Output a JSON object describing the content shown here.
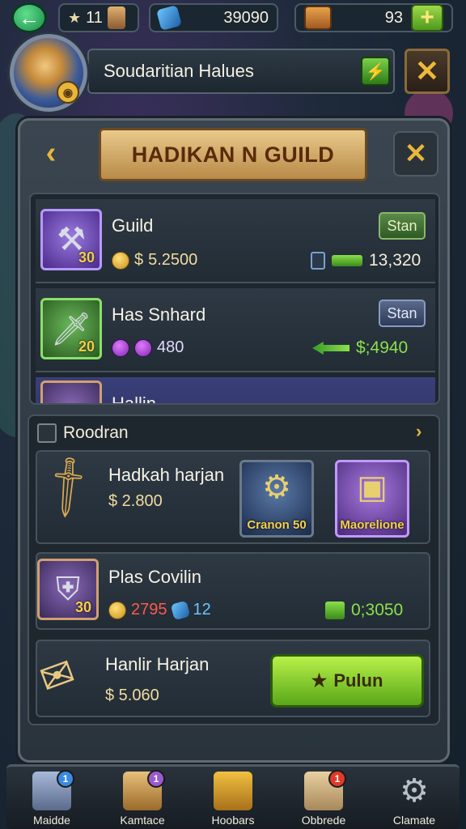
{
  "topbar": {
    "level": "11",
    "gems": "39090",
    "chests": "93"
  },
  "profile": {
    "name": "Soudaritian Halues"
  },
  "panel": {
    "title": "HADIKAN N GUILD"
  },
  "top_list": [
    {
      "name": "Guild",
      "level": "30",
      "cost": "5.2500",
      "button": "Stan",
      "stat": "13,320"
    },
    {
      "name": "Has Snhard",
      "level": "20",
      "cost": "480",
      "button": "Stan",
      "stat": "$;4940"
    },
    {
      "name": "Hallin"
    }
  ],
  "section2": {
    "title": "Roodran",
    "card1": {
      "name": "Hadkah harjan",
      "cost": "$ 2.800",
      "item1_label": "Cranon 50",
      "item2_label": "Maorelione"
    },
    "card2": {
      "name": "Plas Covilin",
      "level": "30",
      "cost_red": "2795",
      "cost_blue": "12",
      "stat": "0;3050"
    },
    "card3": {
      "name": "Hanlir Harjan",
      "cost": "$ 5.060",
      "pull_label": "Pulun"
    }
  },
  "nav": [
    {
      "label": "Maidde",
      "badge": "1"
    },
    {
      "label": "Kamtace",
      "badge": "1"
    },
    {
      "label": "Hoobars",
      "badge": ""
    },
    {
      "label": "Obbrede",
      "badge": "1"
    },
    {
      "label": "Clamate",
      "badge": ""
    }
  ]
}
